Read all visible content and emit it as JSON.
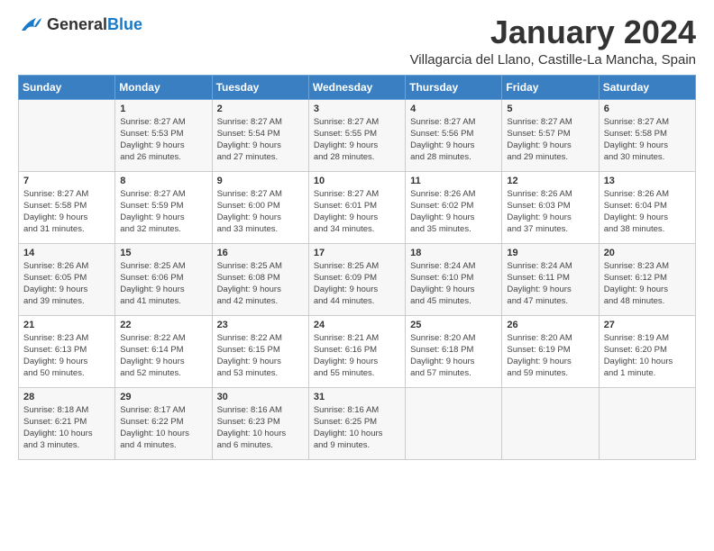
{
  "header": {
    "logo_general": "General",
    "logo_blue": "Blue",
    "month": "January 2024",
    "location": "Villagarcia del Llano, Castille-La Mancha, Spain"
  },
  "weekdays": [
    "Sunday",
    "Monday",
    "Tuesday",
    "Wednesday",
    "Thursday",
    "Friday",
    "Saturday"
  ],
  "weeks": [
    [
      {
        "day": "",
        "content": ""
      },
      {
        "day": "1",
        "content": "Sunrise: 8:27 AM\nSunset: 5:53 PM\nDaylight: 9 hours\nand 26 minutes."
      },
      {
        "day": "2",
        "content": "Sunrise: 8:27 AM\nSunset: 5:54 PM\nDaylight: 9 hours\nand 27 minutes."
      },
      {
        "day": "3",
        "content": "Sunrise: 8:27 AM\nSunset: 5:55 PM\nDaylight: 9 hours\nand 28 minutes."
      },
      {
        "day": "4",
        "content": "Sunrise: 8:27 AM\nSunset: 5:56 PM\nDaylight: 9 hours\nand 28 minutes."
      },
      {
        "day": "5",
        "content": "Sunrise: 8:27 AM\nSunset: 5:57 PM\nDaylight: 9 hours\nand 29 minutes."
      },
      {
        "day": "6",
        "content": "Sunrise: 8:27 AM\nSunset: 5:58 PM\nDaylight: 9 hours\nand 30 minutes."
      }
    ],
    [
      {
        "day": "7",
        "content": "Sunrise: 8:27 AM\nSunset: 5:58 PM\nDaylight: 9 hours\nand 31 minutes."
      },
      {
        "day": "8",
        "content": "Sunrise: 8:27 AM\nSunset: 5:59 PM\nDaylight: 9 hours\nand 32 minutes."
      },
      {
        "day": "9",
        "content": "Sunrise: 8:27 AM\nSunset: 6:00 PM\nDaylight: 9 hours\nand 33 minutes."
      },
      {
        "day": "10",
        "content": "Sunrise: 8:27 AM\nSunset: 6:01 PM\nDaylight: 9 hours\nand 34 minutes."
      },
      {
        "day": "11",
        "content": "Sunrise: 8:26 AM\nSunset: 6:02 PM\nDaylight: 9 hours\nand 35 minutes."
      },
      {
        "day": "12",
        "content": "Sunrise: 8:26 AM\nSunset: 6:03 PM\nDaylight: 9 hours\nand 37 minutes."
      },
      {
        "day": "13",
        "content": "Sunrise: 8:26 AM\nSunset: 6:04 PM\nDaylight: 9 hours\nand 38 minutes."
      }
    ],
    [
      {
        "day": "14",
        "content": "Sunrise: 8:26 AM\nSunset: 6:05 PM\nDaylight: 9 hours\nand 39 minutes."
      },
      {
        "day": "15",
        "content": "Sunrise: 8:25 AM\nSunset: 6:06 PM\nDaylight: 9 hours\nand 41 minutes."
      },
      {
        "day": "16",
        "content": "Sunrise: 8:25 AM\nSunset: 6:08 PM\nDaylight: 9 hours\nand 42 minutes."
      },
      {
        "day": "17",
        "content": "Sunrise: 8:25 AM\nSunset: 6:09 PM\nDaylight: 9 hours\nand 44 minutes."
      },
      {
        "day": "18",
        "content": "Sunrise: 8:24 AM\nSunset: 6:10 PM\nDaylight: 9 hours\nand 45 minutes."
      },
      {
        "day": "19",
        "content": "Sunrise: 8:24 AM\nSunset: 6:11 PM\nDaylight: 9 hours\nand 47 minutes."
      },
      {
        "day": "20",
        "content": "Sunrise: 8:23 AM\nSunset: 6:12 PM\nDaylight: 9 hours\nand 48 minutes."
      }
    ],
    [
      {
        "day": "21",
        "content": "Sunrise: 8:23 AM\nSunset: 6:13 PM\nDaylight: 9 hours\nand 50 minutes."
      },
      {
        "day": "22",
        "content": "Sunrise: 8:22 AM\nSunset: 6:14 PM\nDaylight: 9 hours\nand 52 minutes."
      },
      {
        "day": "23",
        "content": "Sunrise: 8:22 AM\nSunset: 6:15 PM\nDaylight: 9 hours\nand 53 minutes."
      },
      {
        "day": "24",
        "content": "Sunrise: 8:21 AM\nSunset: 6:16 PM\nDaylight: 9 hours\nand 55 minutes."
      },
      {
        "day": "25",
        "content": "Sunrise: 8:20 AM\nSunset: 6:18 PM\nDaylight: 9 hours\nand 57 minutes."
      },
      {
        "day": "26",
        "content": "Sunrise: 8:20 AM\nSunset: 6:19 PM\nDaylight: 9 hours\nand 59 minutes."
      },
      {
        "day": "27",
        "content": "Sunrise: 8:19 AM\nSunset: 6:20 PM\nDaylight: 10 hours\nand 1 minute."
      }
    ],
    [
      {
        "day": "28",
        "content": "Sunrise: 8:18 AM\nSunset: 6:21 PM\nDaylight: 10 hours\nand 3 minutes."
      },
      {
        "day": "29",
        "content": "Sunrise: 8:17 AM\nSunset: 6:22 PM\nDaylight: 10 hours\nand 4 minutes."
      },
      {
        "day": "30",
        "content": "Sunrise: 8:16 AM\nSunset: 6:23 PM\nDaylight: 10 hours\nand 6 minutes."
      },
      {
        "day": "31",
        "content": "Sunrise: 8:16 AM\nSunset: 6:25 PM\nDaylight: 10 hours\nand 9 minutes."
      },
      {
        "day": "",
        "content": ""
      },
      {
        "day": "",
        "content": ""
      },
      {
        "day": "",
        "content": ""
      }
    ]
  ]
}
